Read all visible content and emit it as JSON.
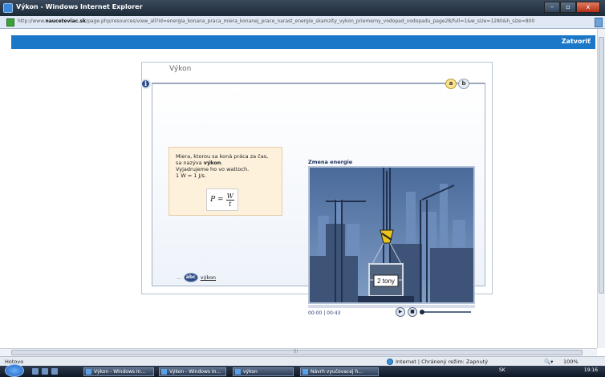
{
  "window": {
    "title": "Výkon - Windows Internet Explorer",
    "buttons": {
      "minimize": "–",
      "maximize": "▫",
      "close": "x"
    }
  },
  "address": {
    "url_prefix": "http://www.",
    "url_domain": "nauceteviac.sk",
    "url_rest": "/page.php/resources/view_all?id=energia_konana_praca_miera_konanej_prace_narast_energie_skamzity_vykon_priemerny_vodopad_vodopadu_page28/full=1&w_size=1280&h_size=800"
  },
  "page": {
    "close_label": "Zatvoriť",
    "lesson": {
      "title": "Výkon",
      "info_icon": "i",
      "tabs": [
        "a",
        "b"
      ],
      "definition": {
        "line1": "Miera, ktorou sa koná práca za čas,",
        "line2a": "sa nazýva ",
        "line2b": "výkon",
        "line2c": ".",
        "line3": "Vyjadrujeme ho vo wattoch.",
        "line4": "1 W = 1 J/s."
      },
      "formula": {
        "lhs": "P =",
        "numerator": "W",
        "denominator": "t"
      },
      "vocab": {
        "dots": "...",
        "icon_label": "abc",
        "word": "výkon"
      },
      "animation": {
        "title": "Zmena energie",
        "load_label": "2 tony",
        "timecode": "00:00 | 00:43"
      }
    }
  },
  "status": {
    "left": "Hotovo",
    "zone": "Internet | Chránený režim: Zapnutý",
    "zoom": "100%",
    "zoom_icon": "🔍▾"
  },
  "taskbar": {
    "tasks": [
      "Výkon - Windows In...",
      "Výkon - Windows In...",
      "výkon",
      "Návrh vyučovacej h..."
    ],
    "tray_lang": "SK",
    "clock": "19:16"
  },
  "colors": {
    "accent_bar": "#1b78c8",
    "definition_bg": "#fdf1dc",
    "animation_bg": "#2b3e5e"
  }
}
